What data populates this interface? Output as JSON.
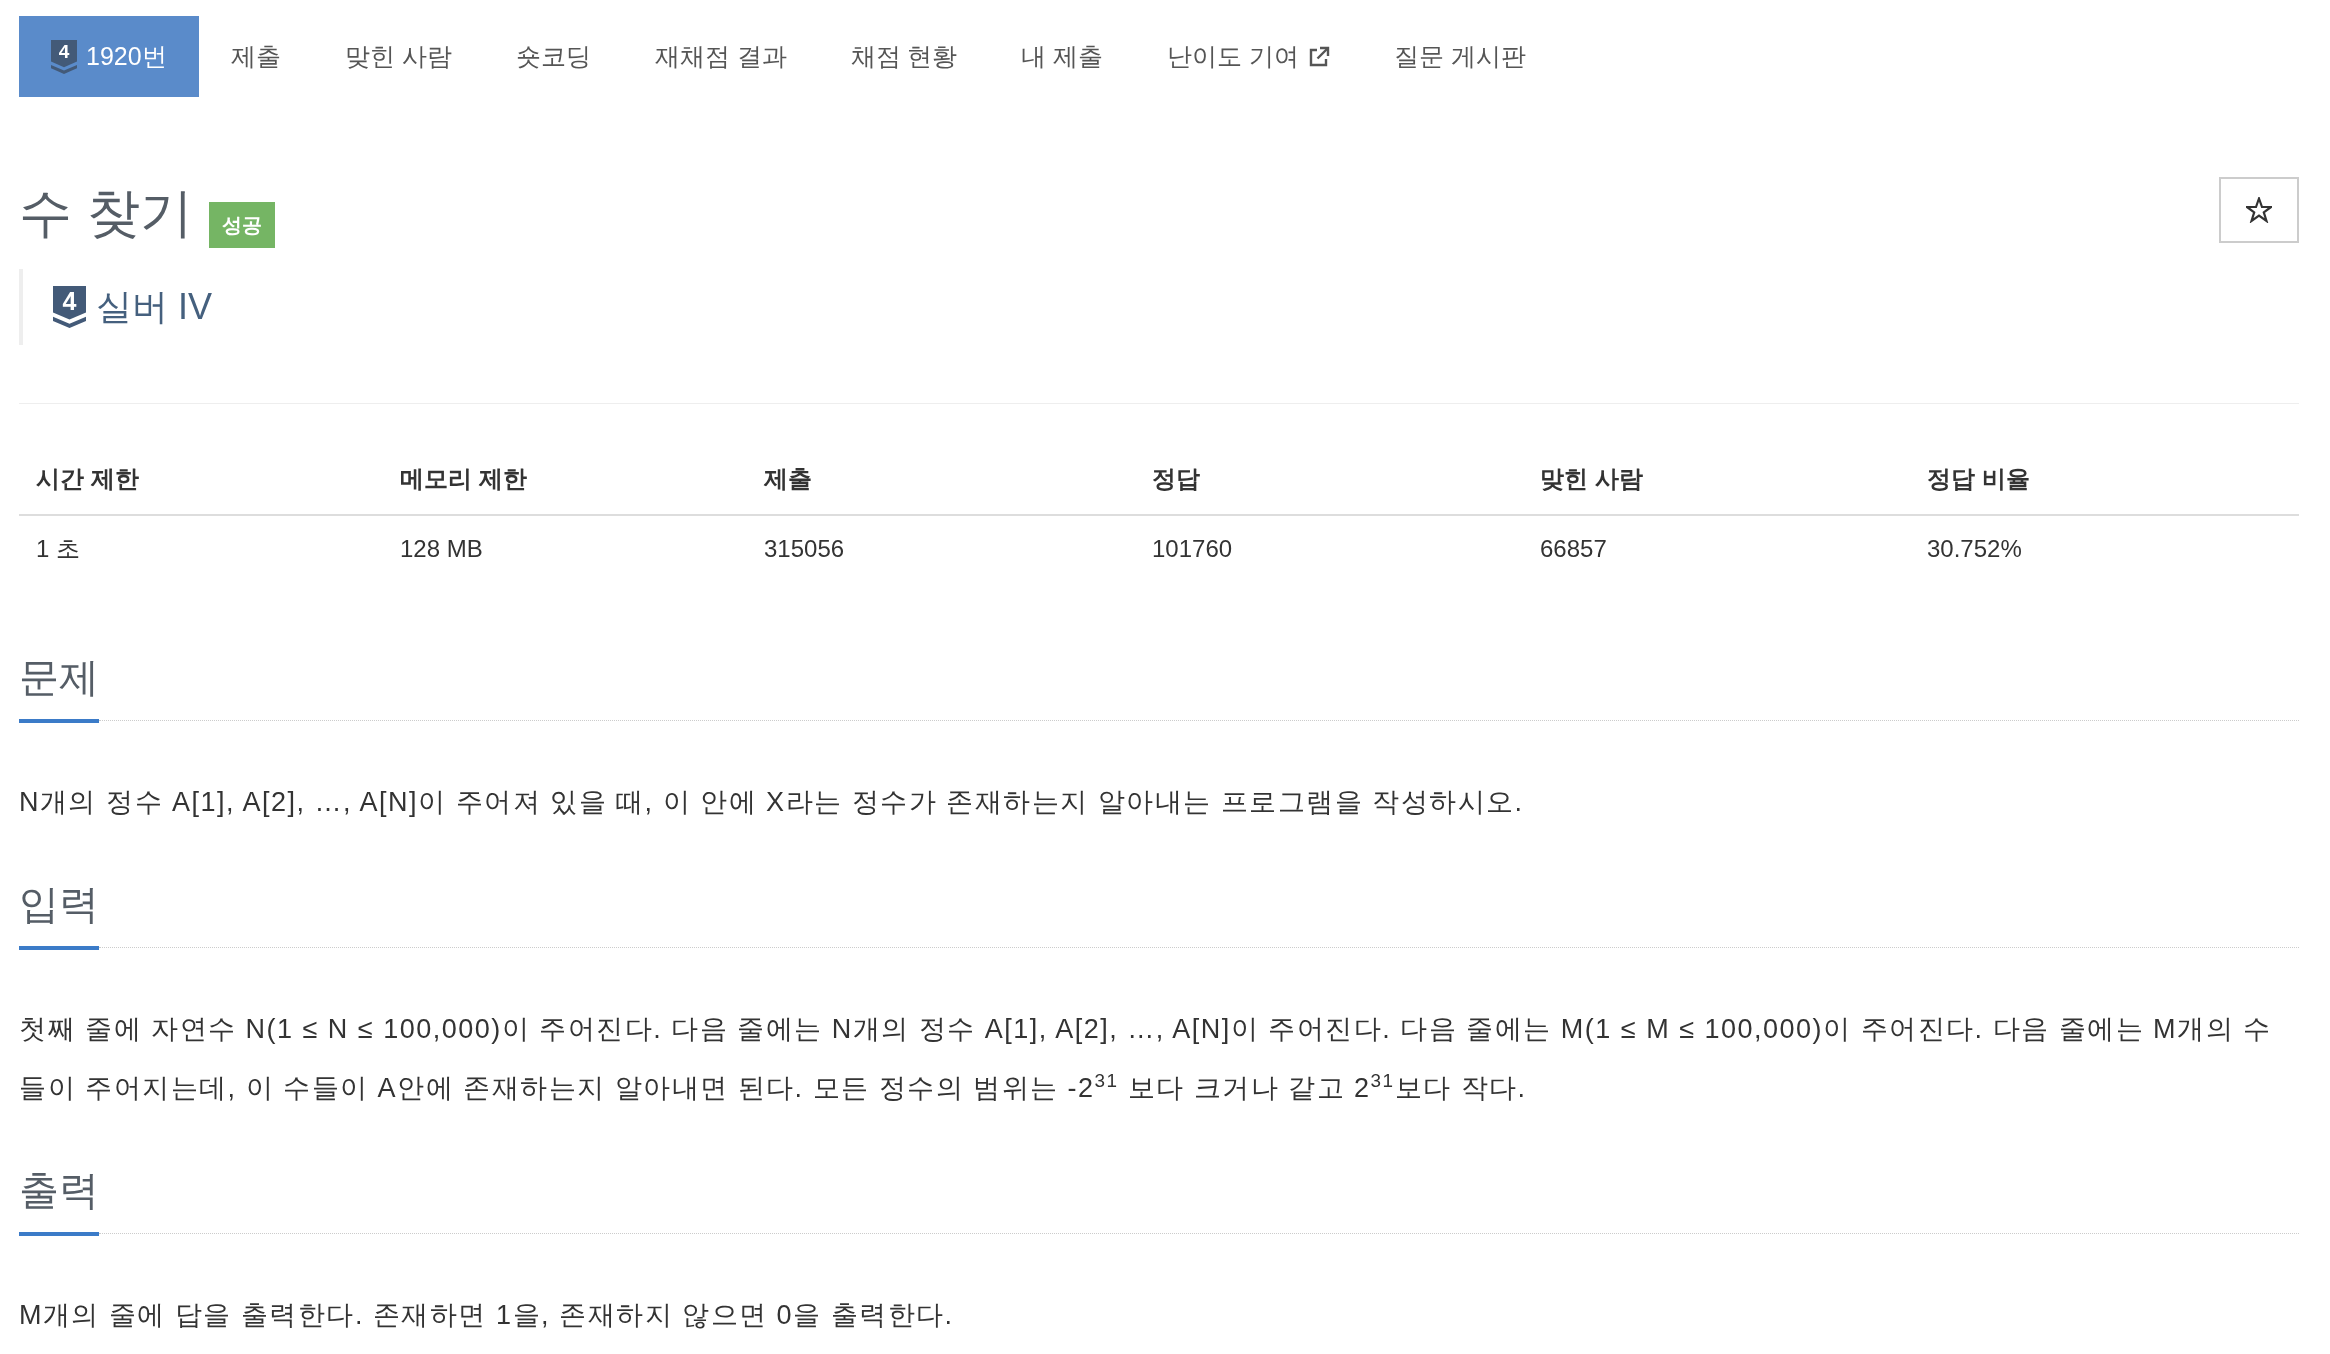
{
  "nav": {
    "tabs": [
      {
        "label": "1920번",
        "tier": "4",
        "selected": true,
        "external": false
      },
      {
        "label": "제출",
        "selected": false,
        "external": false
      },
      {
        "label": "맞힌 사람",
        "selected": false,
        "external": false
      },
      {
        "label": "숏코딩",
        "selected": false,
        "external": false
      },
      {
        "label": "재채점 결과",
        "selected": false,
        "external": false
      },
      {
        "label": "채점 현황",
        "selected": false,
        "external": false
      },
      {
        "label": "내 제출",
        "selected": false,
        "external": false
      },
      {
        "label": "난이도 기여",
        "selected": false,
        "external": true
      },
      {
        "label": "질문 게시판",
        "selected": false,
        "external": false
      }
    ]
  },
  "problem": {
    "title": "수 찾기",
    "status": "성공",
    "tier_badge": "4",
    "tier": "실버 IV",
    "starred": false
  },
  "stats": {
    "columns": [
      "시간 제한",
      "메모리 제한",
      "제출",
      "정답",
      "맞힌 사람",
      "정답 비율"
    ],
    "rows": [
      [
        "1 초",
        "128 MB",
        "315056",
        "101760",
        "66857",
        "30.752%"
      ]
    ]
  },
  "sections": [
    {
      "heading": "문제",
      "text": "N개의 정수 A[1], A[2], …, A[N]이 주어져 있을 때, 이 안에 X라는 정수가 존재하는지 알아내는 프로그램을 작성하시오."
    },
    {
      "heading": "입력",
      "text": "첫째 줄에 자연수 N(1 ≤ N ≤ 100,000)이 주어진다. 다음 줄에는 N개의 정수 A[1], A[2], …, A[N]이 주어진다. 다음 줄에는 M(1 ≤ M ≤ 100,000)이 주어진다. 다음 줄에는 M개의 수들이 주어지는데, 이 수들이 A안에 존재하는지 알아내면 된다. 모든 정수의 범위는 -2$^{31}$ 보다 크거나 같고 2$^{31}$보다 작다."
    },
    {
      "heading": "출력",
      "text": "M개의 줄에 답을 출력한다. 존재하면 1을, 존재하지 않으면 0을 출력한다."
    }
  ]
}
